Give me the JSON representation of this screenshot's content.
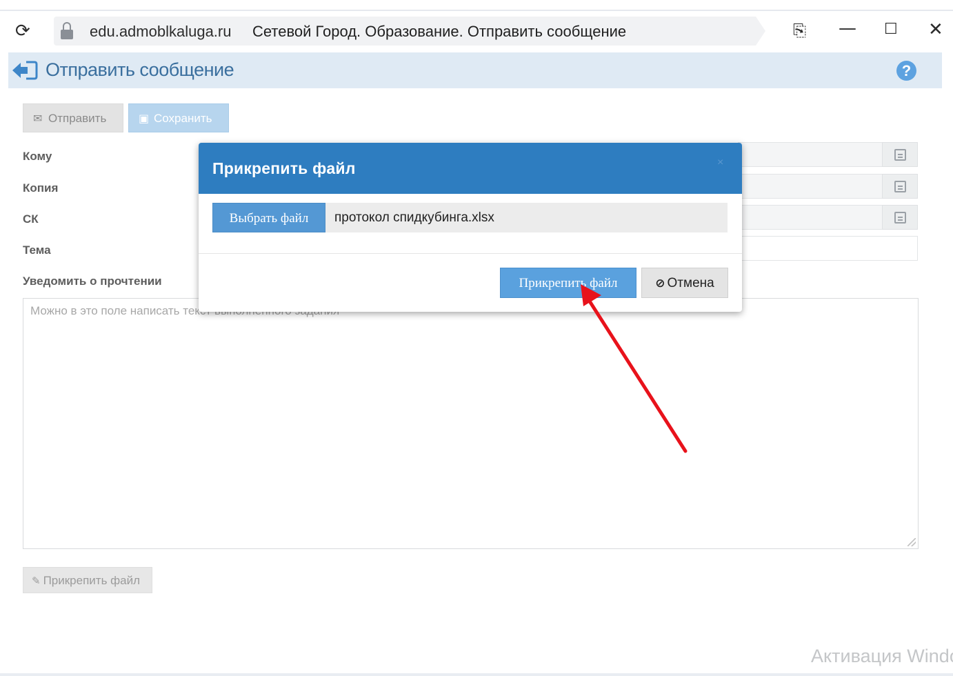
{
  "browser": {
    "url_host": "edu.admoblkaluga.ru",
    "tab_title": "Сетевой Город. Образование. Отправить сообщение",
    "icons": [
      "reload-icon",
      "lock-icon",
      "bookmark-icon",
      "minimize-icon",
      "maximize-icon",
      "close-icon"
    ]
  },
  "header": {
    "title": "Отправить сообщение",
    "back_icon": "back-arrow-icon",
    "help_icon": "?"
  },
  "toolbar": {
    "send_label": "Отправить",
    "send_icon": "envelope-icon",
    "save_label": "Сохранить",
    "save_icon": "floppy-icon"
  },
  "form": {
    "to_label": "Кому",
    "copy_label": "Копия",
    "bcc_label": "СК",
    "subject_label": "Тема",
    "notify_label": "Уведомить о прочтении",
    "message_placeholder": "Можно в это поле написать текст выполненного задания",
    "address_book_icon": "address-book-icon"
  },
  "attach_bottom": {
    "label": "Прикрепить файл",
    "icon": "paperclip-icon"
  },
  "modal": {
    "title": "Прикрепить файл",
    "close_icon": "×",
    "choose_file_label": "Выбрать файл",
    "file_name": "протокол спидкубинга.xlsx",
    "attach_label": "Прикрепить файл",
    "cancel_label": "Отмена",
    "cancel_icon": "⊘"
  },
  "watermark": {
    "text": "Активация Windows"
  },
  "colors": {
    "modal_header": "#2e7dc0",
    "primary_button": "#5aa1de",
    "page_header_bg": "#dfeaf4",
    "annotation_arrow": "#e8121b"
  }
}
